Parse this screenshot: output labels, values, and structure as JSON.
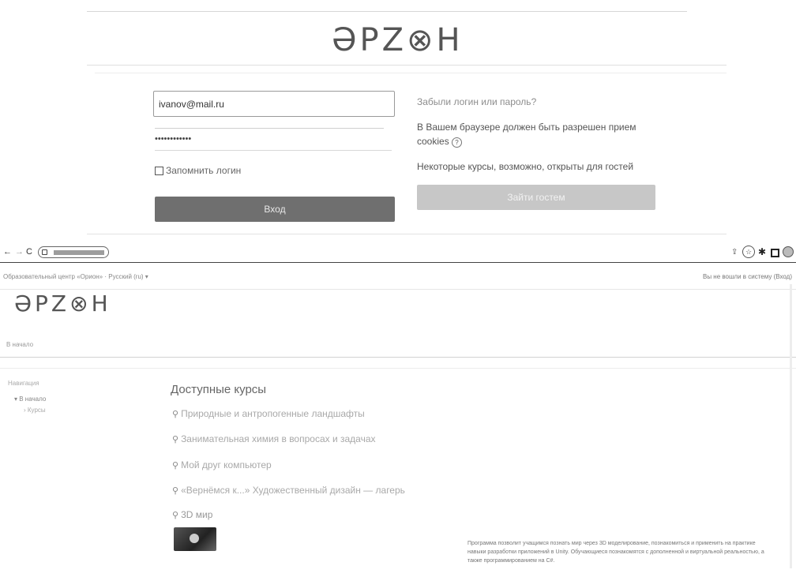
{
  "login": {
    "logo": "ӘРΖ⊗Н",
    "username_value": "ivanov@mail.ru",
    "password_value": "••••••••••••",
    "remember_label": "Запомнить логин",
    "login_button": "Вход",
    "forgot_link": "Забыли логин или пароль?",
    "cookies_text": "В Вашем браузере должен быть разрешен прием cookies",
    "guest_text": "Некоторые курсы, возможно, открыты для гостей",
    "guest_button": "Зайти гостем"
  },
  "browser": {
    "back": "←",
    "forward": "→",
    "reload": "C",
    "address": "",
    "site_title": "Образовательный центр «Орион» · Русский (ru) ▾",
    "user_status": "Вы не вошли в систему (Вход)",
    "toolbar_icons": [
      "share-icon",
      "star-icon",
      "extensions-icon",
      "window-icon",
      "profile-icon"
    ]
  },
  "site": {
    "logo": "ӘРΖ⊗Н",
    "breadcrumb": "В начало",
    "nav_header": "Навигация",
    "nav_items": [
      "В начало",
      "Курсы"
    ],
    "main_heading": "Доступные курсы",
    "courses": [
      "Природные и антропогенные ландшафты",
      "Занимательная химия в вопросах и задачах",
      "Мой друг компьютер",
      "«Вернёмся к...» Художественный дизайн — лагерь",
      "3D мир"
    ],
    "course_description": "Программа позволит учащимся познать мир через 3D моделирование, познакомиться и применить на практике навыки разработки приложений в Unity. Обучающиеся познакомятся с дополненной и виртуальной реальностью, а также программированием на C#."
  }
}
